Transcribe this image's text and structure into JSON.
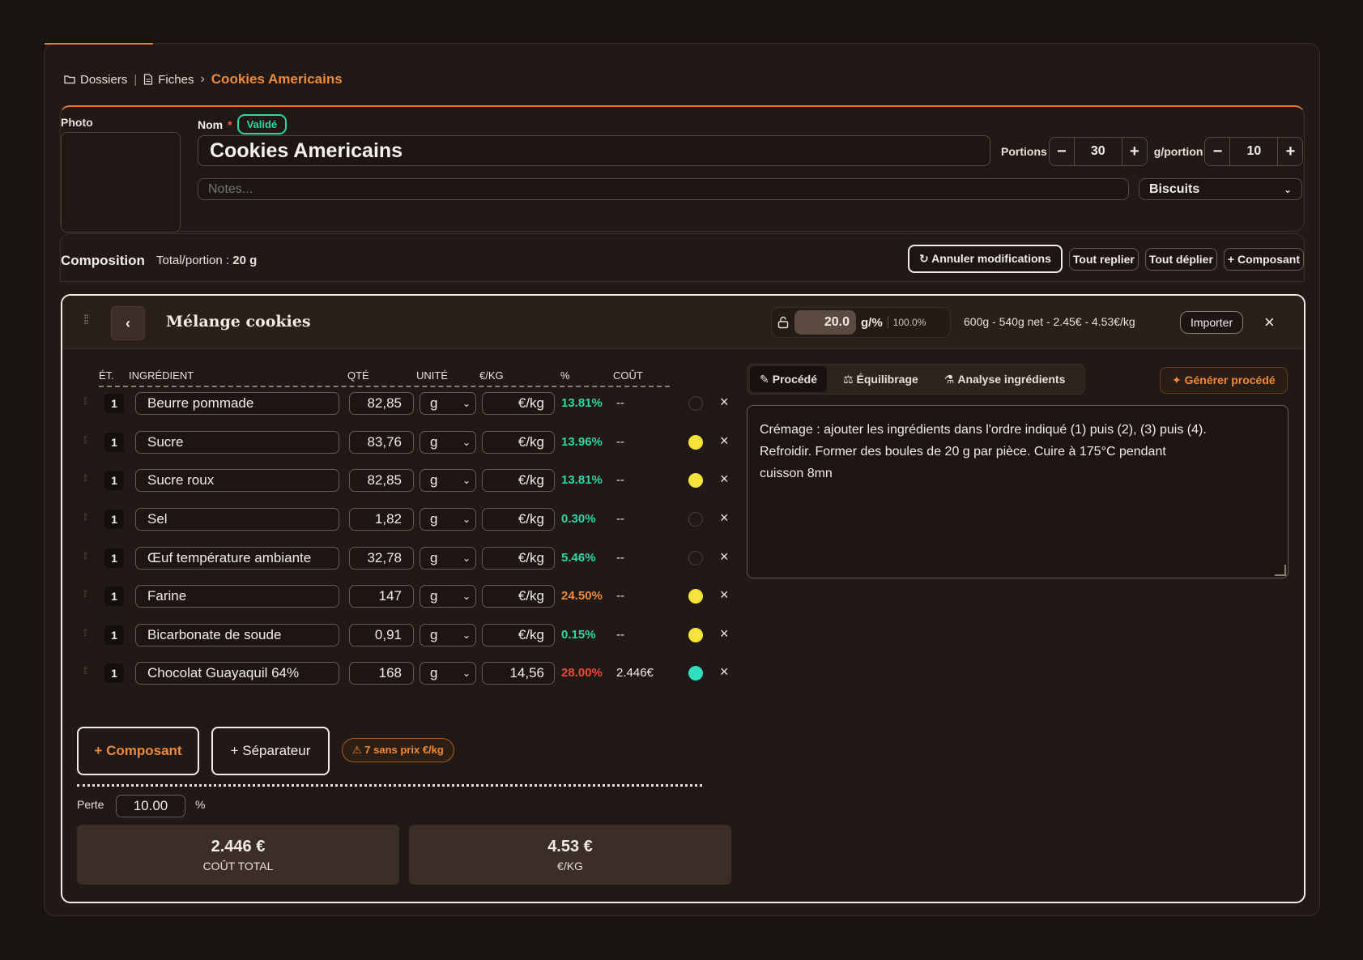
{
  "breadcrumb": {
    "dossiers": "Dossiers",
    "fiches": "Fiches",
    "current": "Cookies Americains"
  },
  "header": {
    "photo_label": "Photo",
    "nom_label": "Nom",
    "required_mark": "*",
    "status_badge": "Validé",
    "name_value": "Cookies Americains",
    "notes_placeholder": "Notes...",
    "portions_label": "Portions",
    "portions_value": "30",
    "gportion_label": "g/portion",
    "gportion_value": "10",
    "category": "Biscuits"
  },
  "composition": {
    "title": "Composition",
    "total_label": "Total/portion :",
    "total_value": "20 g",
    "actions": {
      "cancel": "↻ Annuler modifications",
      "collapse": "Tout replier",
      "expand": "Tout déplier",
      "add": "+ Composant"
    }
  },
  "group": {
    "back": "‹",
    "title": "Mélange cookies",
    "weight_value": "20.0",
    "weight_unit": "g/%",
    "weight_pct": "100.0%",
    "summary": "600g - 540g net - 2.45€ - 4.53€/kg",
    "import": "Importer",
    "close": "×"
  },
  "table": {
    "headers": [
      "ÉT.",
      "INGRÉDIENT",
      "QTÉ",
      "UNITÉ",
      "€/KG",
      "%",
      "COÛT"
    ],
    "rows": [
      {
        "step": "1",
        "name": "Beurre pommade",
        "qty": "82,85",
        "unit": "g",
        "price": "€/kg",
        "pct": "13.81%",
        "pct_color": "#2fd6a6",
        "cost": "--",
        "dot": "empty"
      },
      {
        "step": "1",
        "name": "Sucre",
        "qty": "83,76",
        "unit": "g",
        "price": "€/kg",
        "pct": "13.96%",
        "pct_color": "#2fd6a6",
        "cost": "--",
        "dot": "yellow"
      },
      {
        "step": "1",
        "name": "Sucre roux",
        "qty": "82,85",
        "unit": "g",
        "price": "€/kg",
        "pct": "13.81%",
        "pct_color": "#2fd6a6",
        "cost": "--",
        "dot": "yellow"
      },
      {
        "step": "1",
        "name": "Sel",
        "qty": "1,82",
        "unit": "g",
        "price": "€/kg",
        "pct": "0.30%",
        "pct_color": "#2fd6a6",
        "cost": "--",
        "dot": "empty"
      },
      {
        "step": "1",
        "name": "Œuf température ambiante",
        "qty": "32,78",
        "unit": "g",
        "price": "€/kg",
        "pct": "5.46%",
        "pct_color": "#2fd6a6",
        "cost": "--",
        "dot": "empty"
      },
      {
        "step": "1",
        "name": "Farine",
        "qty": "147",
        "unit": "g",
        "price": "€/kg",
        "pct": "24.50%",
        "pct_color": "#f08a3a",
        "cost": "--",
        "dot": "yellow"
      },
      {
        "step": "1",
        "name": "Bicarbonate de soude",
        "qty": "0,91",
        "unit": "g",
        "price": "€/kg",
        "pct": "0.15%",
        "pct_color": "#2fd6a6",
        "cost": "--",
        "dot": "yellow"
      },
      {
        "step": "1",
        "name": "Chocolat Guayaquil 64%",
        "qty": "168",
        "unit": "g",
        "price": "14,56",
        "pct": "28.00%",
        "pct_color": "#f0473a",
        "cost": "2.446€",
        "dot": "teal"
      }
    ]
  },
  "footer": {
    "add_component": "+ Composant",
    "add_separator": "+ Séparateur",
    "warning": "7 sans prix €/kg",
    "perte_label": "Perte",
    "perte_value": "10.00",
    "perte_unit": "%",
    "total_cost_value": "2.446 €",
    "total_cost_label": "COÛT TOTAL",
    "per_kg_value": "4.53 €",
    "per_kg_label": "€/KG"
  },
  "right": {
    "tabs": [
      "Procédé",
      "Équilibrage",
      "Analyse ingrédients"
    ],
    "generate": "Générer procédé",
    "procede_text": "Crémage : ajouter les ingrédients dans l'ordre indiqué (1) puis (2), (3) puis (4).\nRefroidir. Former des boules de 20 g par pièce. Cuire à 175°C pendant\ncuisson 8mn"
  },
  "colors": {
    "accent": "#f08a3a",
    "valid": "#2fd6a6",
    "dot_yellow": "#f5e33a",
    "dot_teal": "#2fe0c0",
    "pct_red": "#f0473a"
  }
}
